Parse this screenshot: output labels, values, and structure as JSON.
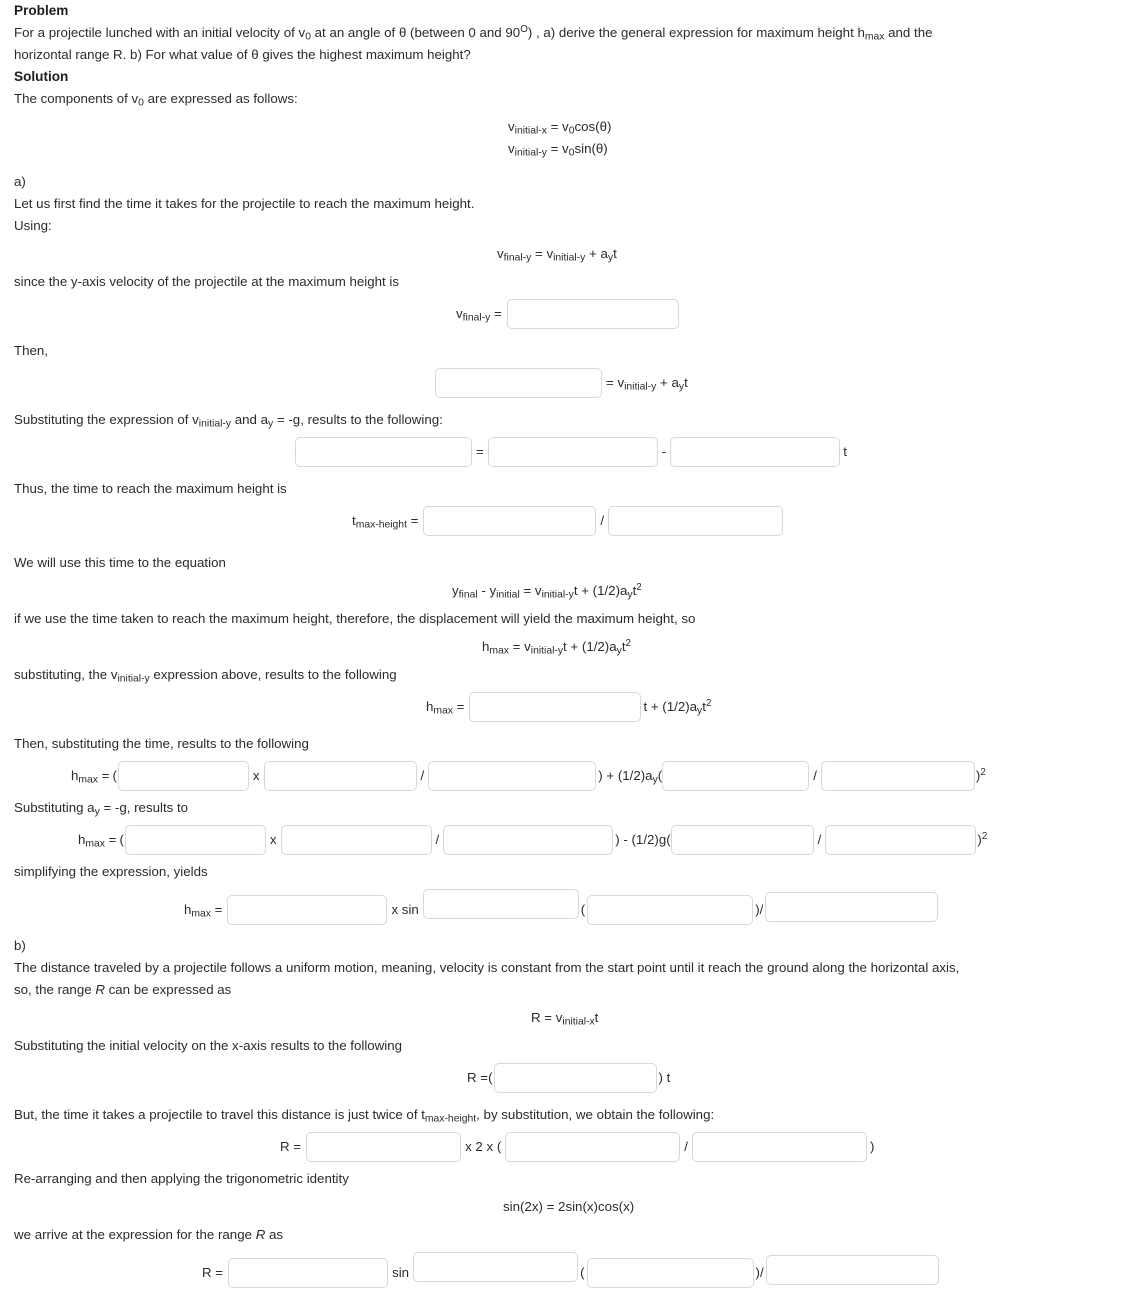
{
  "headings": {
    "problem": "Problem",
    "solution": "Solution"
  },
  "problem": {
    "line1_a": "For a projectile lunched with an initial velocity of v",
    "line1_sub": "0",
    "line1_b": " at an angle of θ (between 0 and 90",
    "line1_sup": "O",
    "line1_c": ") , a) derive the general expression for maximum height h",
    "line1_sub2": "max",
    "line1_d": " and the",
    "line2": "horizontal range R. b) For what value of θ gives the highest maximum height?"
  },
  "solution": {
    "components_intro_a": "The components of v",
    "components_intro_sub": "0",
    "components_intro_b": " are expressed as follows:",
    "eq_vx": {
      "v": "v",
      "sub": "initial-x",
      "eq": " = v",
      "sub0": "0",
      "rest": "cos(θ)"
    },
    "eq_vy": {
      "v": "v",
      "sub": "initial-y",
      "eq": " = v",
      "sub0": "0",
      "rest": "sin(θ)"
    },
    "part_a_label": "a)",
    "a_line1": "Let us first find the time it takes for the projectile to reach the maximum height.",
    "a_line2": "Using:",
    "eq_vfinal": {
      "lhs_v": "v",
      "lhs_sub": "final-y",
      "mid": " = v",
      "rhs_sub": "initial-y",
      "plus": " + a",
      "a_sub": "y",
      "t": "t"
    },
    "a_line3": "since the y-axis velocity of the projectile at the maximum height is",
    "row_vfinal_label_v": "v",
    "row_vfinal_label_sub": "final-y",
    "row_vfinal_label_eq": " =",
    "then_label": "Then,",
    "row_then_eq": " = v",
    "row_then_sub": "initial-y",
    "row_then_plus": " + a",
    "row_then_asub": "y",
    "row_then_t": "t",
    "subst_line_a": "Substituting the expression of v",
    "subst_line_sub": "initial-y",
    "subst_line_b": " and a",
    "subst_line_sub2": "y",
    "subst_line_c": " = -g, results to the following:",
    "op_equals": "=",
    "op_minus": "-",
    "op_t": "t",
    "thus_line": "Thus, the time to reach the maximum height is",
    "tmax_label_t": "t",
    "tmax_label_sub": "max-height",
    "tmax_label_eq": " =",
    "op_divide": "/",
    "use_time_line": "We will use this time to the equation",
    "eq_y": {
      "y1": "y",
      "y1sub": "final",
      "minus": " - y",
      "y2sub": "initial",
      "eq": " = v",
      "vsub": "initial-y",
      "t1": "t + (1/2)a",
      "asub": "y",
      "t2": "t",
      "sup": "2"
    },
    "if_we_use_line": "if we use the time taken to reach the maximum height, therefore, the displacement will yield the maximum height, so",
    "eq_hmax": {
      "h": "h",
      "hsub": "max",
      "eq": " = v",
      "vsub": "initial-y",
      "t1": "t + (1/2)a",
      "asub": "y",
      "t2": "t",
      "sup": "2"
    },
    "subst_vinit_a": "substituting, the v",
    "subst_vinit_sub": "initial-y",
    "subst_vinit_b": " expression above, results to the following",
    "row_hmax_label_h": "h",
    "row_hmax_label_sub": "max",
    "row_hmax_label_eq": " =",
    "row_hmax_tail_t": "t + (1/2)a",
    "row_hmax_tail_sub": "y",
    "row_hmax_tail_t2": "t",
    "row_hmax_tail_sup": "2",
    "then_subst_time": "Then, substituting the time, results to the following",
    "op_paren_open": "(",
    "op_x": "x",
    "op_paren_close_plus": ") + (1/2)a",
    "op_plus_asub": "y",
    "op_paren_open2": "(",
    "op_sup2": "2",
    "op_paren_close_sup": ")",
    "subst_ay_a": "Substituting a",
    "subst_ay_sub": "y",
    "subst_ay_b": " = -g, results to",
    "op_paren_close_minus": ") - (1/2)g",
    "simplifying_line": "simplifying the expression, yields",
    "op_xsin": "x sin",
    "part_b_label": "b)",
    "b_line1_a": "The distance traveled by a projectile follows a uniform motion, meaning, velocity is constant from the start point until it reach the ground along the horizontal axis,",
    "b_line2_a": "so, the range ",
    "b_line2_ital": "R",
    "b_line2_b": " can be expressed as",
    "eq_range": {
      "r": "R = v",
      "sub": "initial-x",
      "t": "t"
    },
    "subst_initial_vel": "Substituting the initial velocity on the x-axis results to the following",
    "row_R_label": "R = ",
    "row_R_paren_open": "(",
    "row_R_paren_close_t": ") t",
    "but_line_a": "But, the time it takes a projectile to travel this distance is just twice of t",
    "but_line_sub": "max-height",
    "but_line_b": ", by substitution, we obtain the following:",
    "row_R2_label": "R =",
    "op_x2x": "x 2 x (",
    "rearranging_line": "Re-arranging and then applying the trigonometric identity",
    "eq_identity": "sin(2x) = 2sin(x)cos(x)",
    "arrive_line_a": "we arrive at the expression for the range ",
    "arrive_line_ital": "R",
    "arrive_line_b": " as",
    "row_R3_label": "R =",
    "op_sin": "sin"
  },
  "inputs": {
    "placeholder": "",
    "vfinal_value": "",
    "then_value": "",
    "subst_left": "",
    "subst_mid": "",
    "subst_right": "",
    "tmax_left": "",
    "tmax_right": "",
    "hmax_sub": "",
    "hmax_t1": "",
    "hmax_t2": "",
    "hmax_t3": "",
    "hmax_t4": "",
    "hmax_t5": "",
    "hmaxg_1": "",
    "hmaxg_2": "",
    "hmaxg_3": "",
    "hmaxg_4": "",
    "hmaxg_5": "",
    "simp_1": "",
    "simp_2": "",
    "simp_3": "",
    "simp_4": "",
    "range_1": "",
    "range2_1": "",
    "range2_2": "",
    "range2_3": "",
    "range3_1": "",
    "range3_2": "",
    "range3_3": "",
    "range3_4": ""
  },
  "colors": {
    "text": "#2b2b2b",
    "border": "#d8d8d8",
    "background": "#ffffff"
  }
}
